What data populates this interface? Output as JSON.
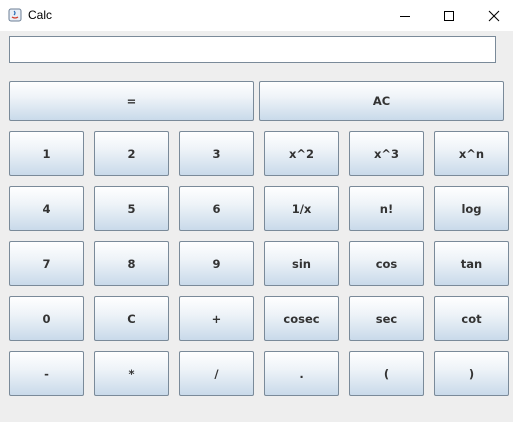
{
  "window": {
    "title": "Calc"
  },
  "display": {
    "value": ""
  },
  "top_buttons": [
    "=",
    "AC"
  ],
  "rows": [
    [
      "1",
      "2",
      "3",
      "x^2",
      "x^3",
      "x^n"
    ],
    [
      "4",
      "5",
      "6",
      "1/x",
      "n!",
      "log"
    ],
    [
      "7",
      "8",
      "9",
      "sin",
      "cos",
      "tan"
    ],
    [
      "0",
      "C",
      "+",
      "cosec",
      "sec",
      "cot"
    ],
    [
      "-",
      "*",
      "/",
      ".",
      "(",
      ")"
    ]
  ]
}
